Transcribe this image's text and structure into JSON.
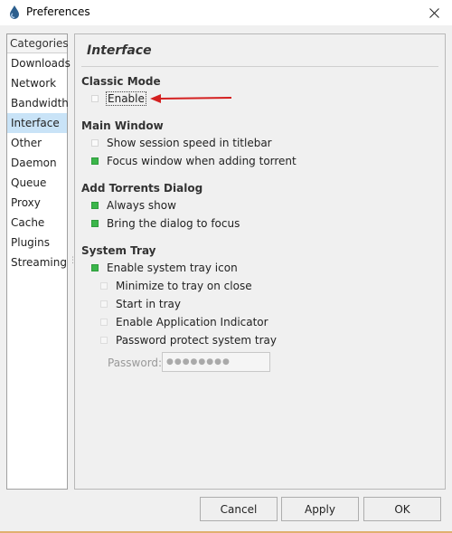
{
  "window": {
    "title": "Preferences"
  },
  "sidebar": {
    "header": "Categories",
    "items": [
      "Downloads",
      "Network",
      "Bandwidth",
      "Interface",
      "Other",
      "Daemon",
      "Queue",
      "Proxy",
      "Cache",
      "Plugins",
      "Streaming"
    ],
    "selected": "Interface"
  },
  "panel": {
    "title": "Interface",
    "classic_mode": {
      "heading": "Classic Mode",
      "enable": {
        "label": "Enable",
        "checked": false
      }
    },
    "main_window": {
      "heading": "Main Window",
      "options": [
        {
          "label": "Show session speed in titlebar",
          "checked": false
        },
        {
          "label": "Focus window when adding torrent",
          "checked": true
        }
      ]
    },
    "add_torrents_dialog": {
      "heading": "Add Torrents Dialog",
      "options": [
        {
          "label": "Always show",
          "checked": true
        },
        {
          "label": "Bring the dialog to focus",
          "checked": true
        }
      ]
    },
    "system_tray": {
      "heading": "System Tray",
      "enable": {
        "label": "Enable system tray icon",
        "checked": true
      },
      "options": [
        {
          "label": "Minimize to tray on close",
          "checked": false
        },
        {
          "label": "Start in tray",
          "checked": false
        },
        {
          "label": "Enable Application Indicator",
          "checked": false
        },
        {
          "label": "Password protect system tray",
          "checked": false
        }
      ],
      "password_label": "Password:",
      "password_value": "●●●●●●●●"
    }
  },
  "buttons": {
    "cancel": "Cancel",
    "apply": "Apply",
    "ok": "OK"
  },
  "colors": {
    "selected_bg": "#c9e3f7",
    "checked": "#3bb54a",
    "arrow": "#d42020"
  }
}
